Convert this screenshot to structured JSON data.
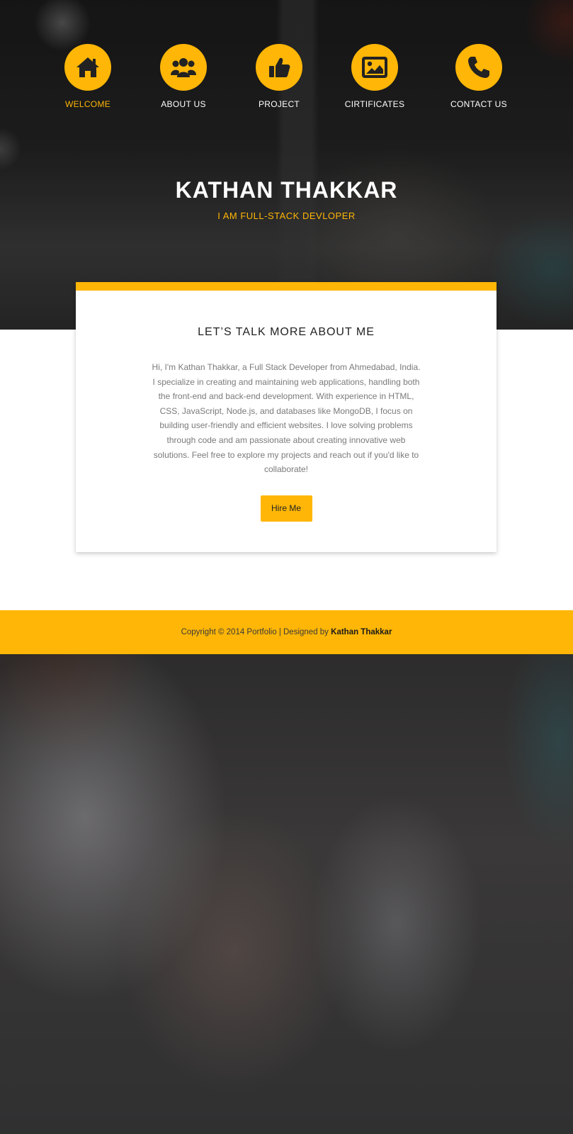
{
  "nav": {
    "items": [
      {
        "label": "WELCOME",
        "icon": "home-icon",
        "active": true
      },
      {
        "label": "ABOUT US",
        "icon": "users-icon",
        "active": false
      },
      {
        "label": "PROJECT",
        "icon": "thumbs-up-icon",
        "active": false
      },
      {
        "label": "CIRTIFICATES",
        "icon": "image-icon",
        "active": false
      },
      {
        "label": "CONTACT US",
        "icon": "phone-icon",
        "active": false
      }
    ]
  },
  "hero": {
    "name": "KATHAN THAKKAR",
    "tagline": "I AM FULL-STACK DEVLOPER"
  },
  "about": {
    "title": "LET’S TALK MORE ABOUT ME",
    "text": "Hi, I'm Kathan Thakkar, a Full Stack Developer from Ahmedabad, India. I specialize in creating and maintaining web applications, handling both the front-end and back-end development. With experience in HTML, CSS, JavaScript, Node.js, and databases like MongoDB, I focus on building user-friendly and efficient websites. I love solving problems through code and am passionate about creating innovative web solutions. Feel free to explore my projects and reach out if you'd like to collaborate!",
    "button_label": "Hire Me"
  },
  "footer": {
    "copyright": "Copyright © 2014 Portfolio | Designed by",
    "author": "Kathan Thakkar"
  },
  "colors": {
    "accent": "#ffb606",
    "white": "#ffffff",
    "dark_text": "#222222",
    "body_text": "#7a7a7a"
  }
}
